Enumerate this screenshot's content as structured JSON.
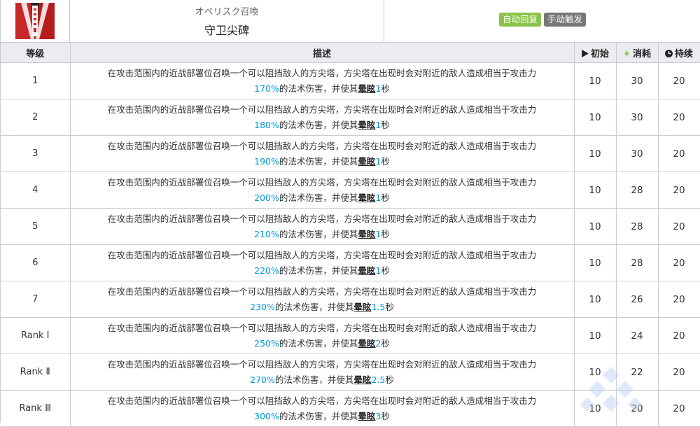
{
  "skill": {
    "icon": "obelisk-skill-icon",
    "name_jp": "オベリスク召喚",
    "name_cn": "守卫尖碑",
    "tags": {
      "auto_recovery": "自动回复",
      "manual_trigger": "手动触发"
    },
    "colors": {
      "auto_recovery": "#8bc34a",
      "manual_trigger": "#777777",
      "highlight": "#0098dc"
    }
  },
  "table": {
    "headers": {
      "level": "等级",
      "description": "描述",
      "initial": "初始",
      "cost": "消耗",
      "duration": "持续"
    },
    "header_icons": {
      "initial": "play-icon",
      "cost": "lightning-icon",
      "duration": "clock-icon"
    },
    "desc_line1": "在攻击范围内的近战部署位召唤一个可以阻挡敌人的方尖塔，方尖塔在出现时会对附近的敌人造成相当于攻击力",
    "desc_text_a": "的法术伤害，并使其",
    "desc_keyword": "晕眩",
    "desc_text_b": "秒",
    "rows": [
      {
        "level": "1",
        "percent": "170%",
        "stun": "1",
        "initial": "10",
        "cost": "30",
        "duration": "20"
      },
      {
        "level": "2",
        "percent": "180%",
        "stun": "1",
        "initial": "10",
        "cost": "30",
        "duration": "20"
      },
      {
        "level": "3",
        "percent": "190%",
        "stun": "1",
        "initial": "10",
        "cost": "30",
        "duration": "20"
      },
      {
        "level": "4",
        "percent": "200%",
        "stun": "1",
        "initial": "10",
        "cost": "28",
        "duration": "20"
      },
      {
        "level": "5",
        "percent": "210%",
        "stun": "1",
        "initial": "10",
        "cost": "28",
        "duration": "20"
      },
      {
        "level": "6",
        "percent": "220%",
        "stun": "1",
        "initial": "10",
        "cost": "28",
        "duration": "20"
      },
      {
        "level": "7",
        "percent": "230%",
        "stun": "1.5",
        "initial": "10",
        "cost": "26",
        "duration": "20"
      },
      {
        "level": "Rank Ⅰ",
        "percent": "250%",
        "stun": "2",
        "initial": "10",
        "cost": "24",
        "duration": "20"
      },
      {
        "level": "Rank Ⅱ",
        "percent": "270%",
        "stun": "2.5",
        "initial": "10",
        "cost": "22",
        "duration": "20"
      },
      {
        "level": "Rank Ⅲ",
        "percent": "300%",
        "stun": "3",
        "initial": "10",
        "cost": "20",
        "duration": "20"
      }
    ]
  }
}
